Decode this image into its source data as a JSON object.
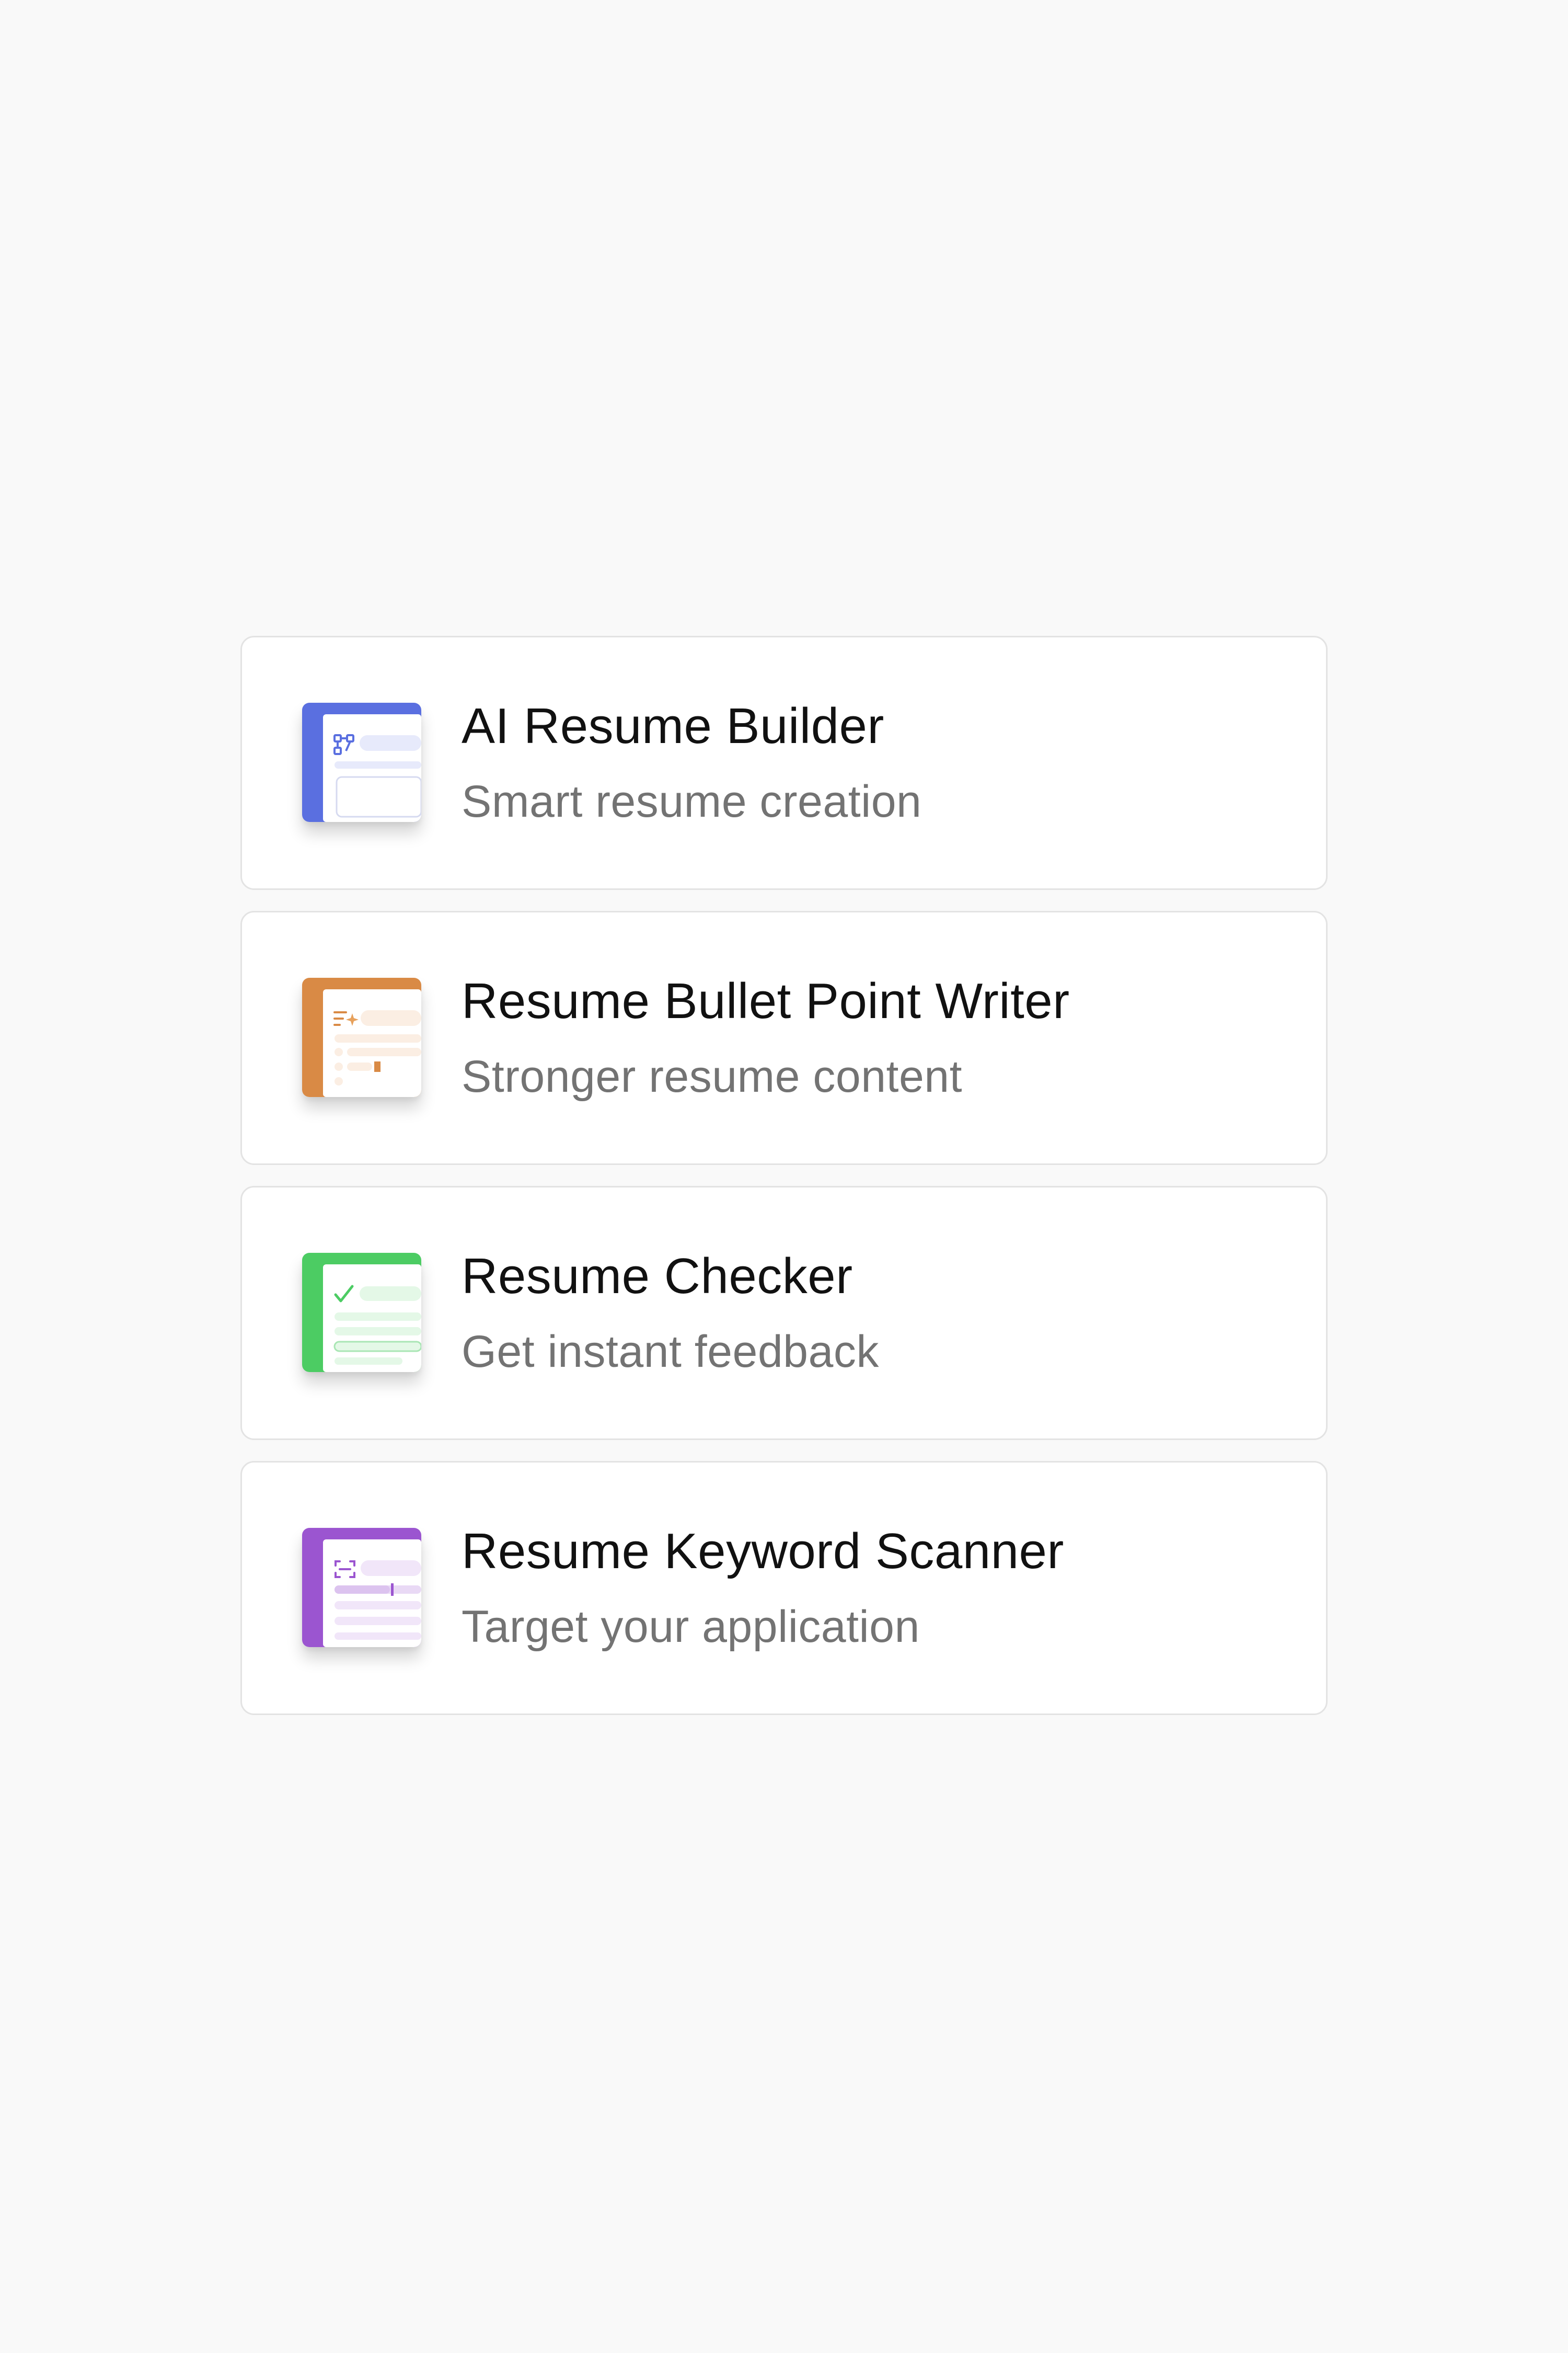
{
  "tools": [
    {
      "title": "AI Resume Builder",
      "subtitle": "Smart resume creation",
      "icon": "resume-builder-icon",
      "accent": "#5a6fe0"
    },
    {
      "title": "Resume Bullet Point Writer",
      "subtitle": "Stronger resume content",
      "icon": "bullet-writer-icon",
      "accent": "#d98a45"
    },
    {
      "title": "Resume Checker",
      "subtitle": "Get instant feedback",
      "icon": "resume-checker-icon",
      "accent": "#4ccc63"
    },
    {
      "title": "Resume Keyword Scanner",
      "subtitle": "Target your application",
      "icon": "keyword-scanner-icon",
      "accent": "#9b55d0"
    }
  ]
}
